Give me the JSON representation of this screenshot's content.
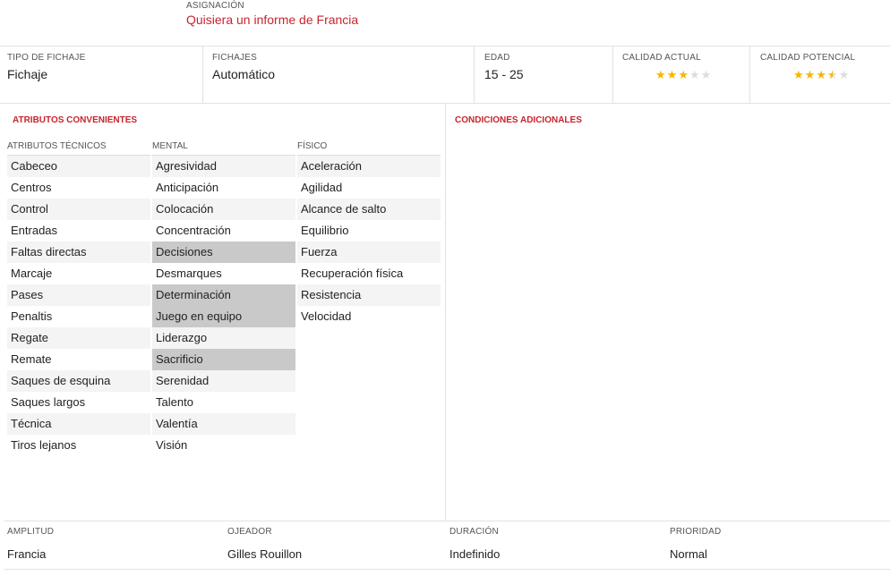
{
  "header": {
    "assignment_label": "ASIGNACIÓN",
    "assignment_value": "Quisiera un informe de Francia"
  },
  "info": {
    "tipo_label": "TIPO DE FICHAJE",
    "tipo_value": "Fichaje",
    "fichajes_label": "FICHAJES",
    "fichajes_value": "Automático",
    "edad_label": "EDAD",
    "edad_value": "15 - 25",
    "calidad_actual_label": "CALIDAD ACTUAL",
    "calidad_actual_stars": 3,
    "calidad_potencial_label": "CALIDAD POTENCIAL",
    "calidad_potencial_stars": 3.5,
    "star_max": 5,
    "star_color": "#f2b705"
  },
  "attributes": {
    "section_title": "ATRIBUTOS CONVENIENTES",
    "tecnicos_label": "ATRIBUTOS TÉCNICOS",
    "tecnicos": [
      "Cabeceo",
      "Centros",
      "Control",
      "Entradas",
      "Faltas directas",
      "Marcaje",
      "Pases",
      "Penaltis",
      "Regate",
      "Remate",
      "Saques de esquina",
      "Saques largos",
      "Técnica",
      "Tiros lejanos"
    ],
    "mental_label": "MENTAL",
    "mental": [
      "Agresividad",
      "Anticipación",
      "Colocación",
      "Concentración",
      "Decisiones",
      "Desmarques",
      "Determinación",
      "Juego en equipo",
      "Liderazgo",
      "Sacrificio",
      "Serenidad",
      "Talento",
      "Valentía",
      "Visión"
    ],
    "mental_highlighted": [
      "Decisiones",
      "Determinación",
      "Juego en equipo",
      "Sacrificio"
    ],
    "fisico_label": "FÍSICO",
    "fisico": [
      "Aceleración",
      "Agilidad",
      "Alcance de salto",
      "Equilibrio",
      "Fuerza",
      "Recuperación física",
      "Resistencia",
      "Velocidad"
    ],
    "highlight_color": "#c9c9c9"
  },
  "conditions": {
    "section_title": "CONDICIONES ADICIONALES"
  },
  "footer": {
    "amplitud_label": "AMPLITUD",
    "amplitud_value": "Francia",
    "ojeador_label": "OJEADOR",
    "ojeador_value": "Gilles Rouillon",
    "duracion_label": "DURACIÓN",
    "duracion_value": "Indefinido",
    "prioridad_label": "PRIORIDAD",
    "prioridad_value": "Normal"
  },
  "accent_color": "#c8242e"
}
